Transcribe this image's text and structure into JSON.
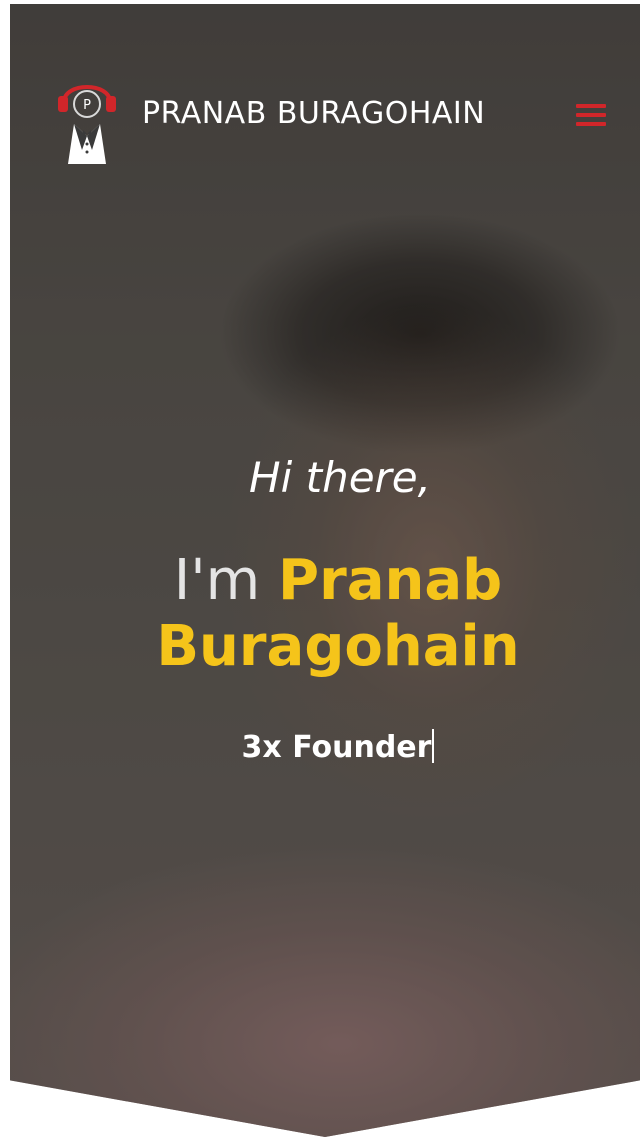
{
  "header": {
    "brand_name": "PRANAB BURAGOHAIN",
    "logo_icon": "headphones-tuxedo-logo",
    "menu_icon": "hamburger-menu-icon",
    "logo_letter": "P"
  },
  "hero": {
    "greeting": "Hi there,",
    "intro": "I'm",
    "name": "Pranab Buragohain",
    "typed_text": "3x Founder"
  },
  "colors": {
    "accent_yellow": "#f5c41a",
    "menu_red": "#d1262a",
    "logo_red": "#d1262a",
    "text_white": "#ffffff"
  }
}
